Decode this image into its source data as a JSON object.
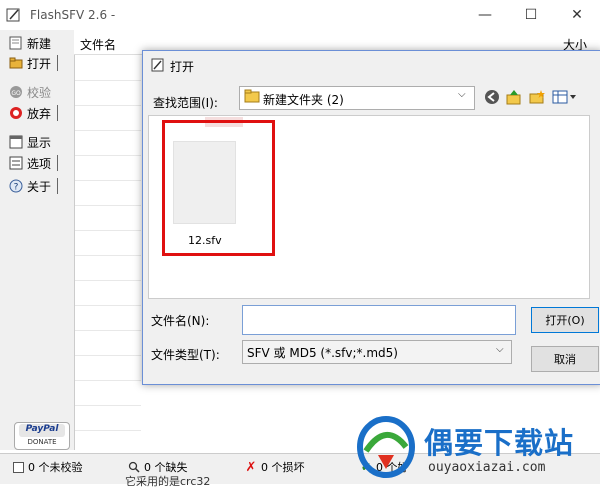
{
  "window": {
    "title": "FlashSFV 2.6 -",
    "minimize": "—",
    "maximize": "☐",
    "close": "✕"
  },
  "sidebar": {
    "items": [
      {
        "label": "新建",
        "icon": "new-document-icon"
      },
      {
        "label": "打开",
        "icon": "open-folder-icon"
      },
      {
        "label": "校验",
        "icon": "go-icon"
      },
      {
        "label": "放弃",
        "icon": "stop-icon"
      },
      {
        "label": "显示",
        "icon": "display-icon"
      },
      {
        "label": "选项",
        "icon": "options-icon"
      },
      {
        "label": "关于",
        "icon": "help-icon"
      }
    ]
  },
  "list": {
    "columns": [
      "文件名",
      "大小"
    ]
  },
  "paypal": {
    "brand": "PayPal",
    "donate": "DONATE"
  },
  "status": {
    "unchecked": "0 个未校验",
    "missing": "0 个缺失",
    "damaged": "0 个损坏",
    "good": "0 个好",
    "bottom_text": "它采用的是crc32"
  },
  "dialog": {
    "title": "打开",
    "lookin_label": "查找范围(I):",
    "lookin_value": "新建文件夹 (2)",
    "file": {
      "name": "12.sfv"
    },
    "filename_label": "文件名(N):",
    "filename_value": "",
    "filetype_label": "文件类型(T):",
    "filetype_value": "SFV 或 MD5 (*.sfv;*.md5)",
    "open_button": "打开(O)",
    "cancel_button": "取消"
  },
  "watermark": {
    "name": "偶要下载站",
    "url": "ouyaoxiazai.com"
  },
  "colors": {
    "highlight": "#e01010",
    "watermark_blue": "#1a6fc8",
    "dialog_border": "#6b8fd6"
  }
}
